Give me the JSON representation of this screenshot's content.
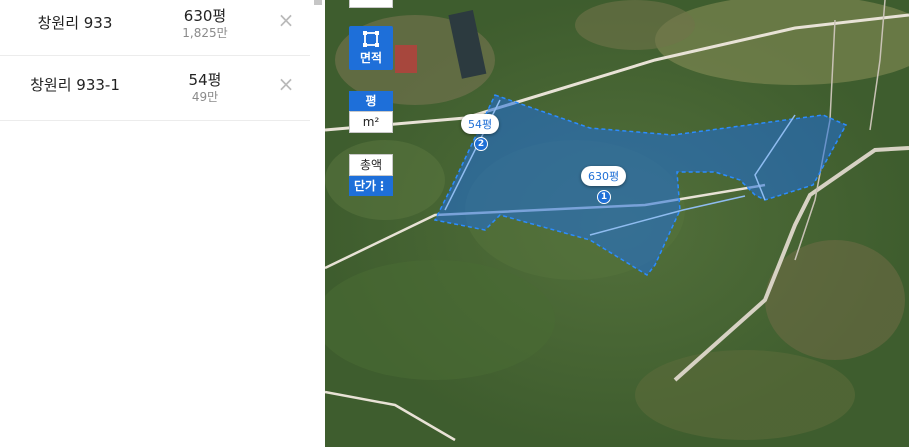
{
  "parcels": [
    {
      "name": "창원리 933",
      "area": "630평",
      "price": "1,825만",
      "badge": "1"
    },
    {
      "name": "창원리 933-1",
      "area": "54평",
      "price": "49만",
      "badge": "2"
    }
  ],
  "icons": {
    "remove": "×",
    "area_tool": "area-square-icon",
    "units_toggle": "⋮"
  },
  "controls": {
    "area_label": "면적",
    "unit_pyeong": "평",
    "unit_m2": "m²",
    "total_label": "총액",
    "unit_price_label": "단가"
  },
  "colors": {
    "accent": "#1e6fd9",
    "parcel_fill": "rgba(30,110,220,0.55)",
    "parcel_stroke": "#2c8cff"
  }
}
